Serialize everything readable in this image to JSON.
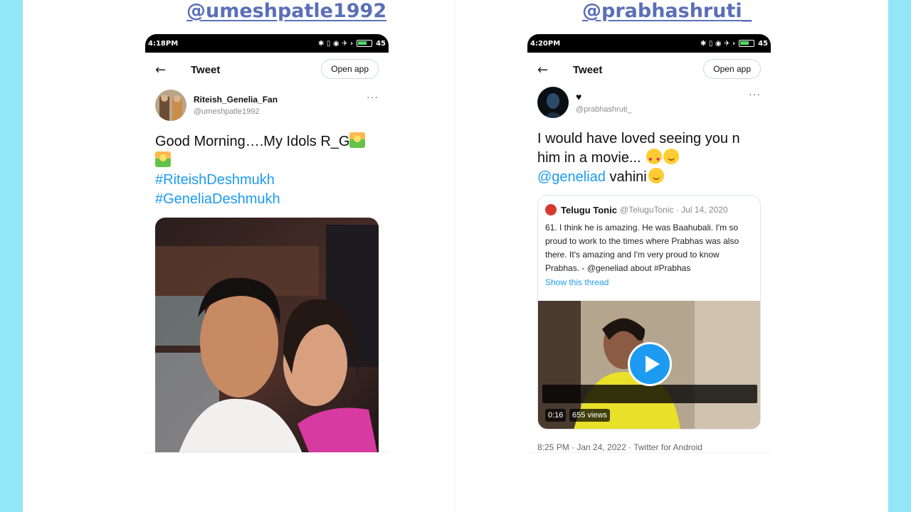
{
  "left": {
    "handle": "@umeshpatle1992",
    "phone": {
      "time": "4:18PM",
      "status_icons": "✱ ▯ ◉ ✈ ›",
      "battery": "45",
      "back_icon": "arrow-left-icon",
      "title": "Tweet",
      "open_app": "Open app",
      "author_name": "Riteish_Genelia_Fan",
      "author_handle": "@umeshpatle1992",
      "more": "···",
      "text_line": "Good Morning….My Idols R_G",
      "hashtag1": "#RiteishDeshmukh",
      "hashtag2": "#GeneliaDeshmukh",
      "media": "photo"
    }
  },
  "right": {
    "handle": "@prabhashruti_",
    "phone": {
      "time": "4:20PM",
      "status_icons": "✱ ▯ ◉ ✈ ›",
      "battery": "45",
      "back_icon": "arrow-left-icon",
      "title": "Tweet",
      "open_app": "Open app",
      "author_name": "♥",
      "author_handle": "@prabhashruti_",
      "more": "···",
      "text_line": "I would have loved seeing you n him in a movie...",
      "mention": "@geneliad",
      "after_mention": " vahini",
      "quote": {
        "name": "Telugu Tonic",
        "meta": "@TeluguTonic · Jul 14, 2020",
        "body": "61. I think he is amazing. He was Baahubali. I'm so proud to work to the times where Prabhas was also there. It's amazing and I'm very proud to know Prabhas. - @geneliad about #Prabhas",
        "show_thread": "Show this thread",
        "duration": "0:16",
        "views": "655 views"
      },
      "timestamp": "8:25 PM · Jan 24, 2022 · Twitter for Android"
    }
  },
  "nav_icons": [
    "home-icon",
    "search-icon",
    "bell-icon",
    "mail-icon"
  ],
  "colors": {
    "page_bg": "#93e6f7",
    "handle": "#5b6fb8",
    "twitter_blue": "#1d9bf0"
  }
}
